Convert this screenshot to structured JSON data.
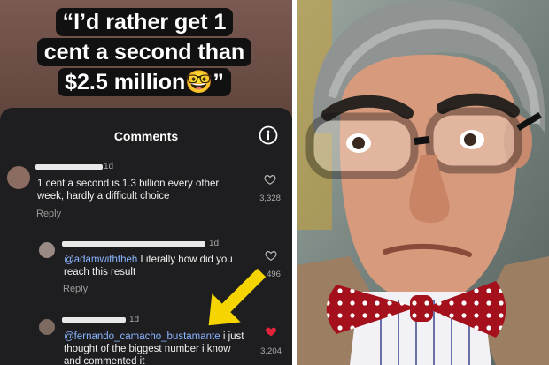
{
  "caption": {
    "line1": "“I’d rather get 1",
    "line2": "cent a second than",
    "line3": "$2.5 million🤓”"
  },
  "sheet": {
    "title": "Comments",
    "info_icon": "info-icon"
  },
  "comments": [
    {
      "time": "1d",
      "text": "1 cent a second is 1.3 billion every other week, hardly a difficult choice",
      "reply": "Reply",
      "likes": "3,328",
      "liked": false
    },
    {
      "time": "1d",
      "mention": "@adamwiththeh",
      "text": " Literally how did you reach this result",
      "reply": "Reply",
      "likes": "496",
      "liked": false
    },
    {
      "time": "1d",
      "mention": "@fernando_camacho_bustamante",
      "text": " i just thought of the biggest number i know and commented it",
      "likes": "3,204",
      "liked": true
    }
  ],
  "colors": {
    "arrow": "#f5d400",
    "heart_liked": "#e0243a",
    "mention": "#8ab4ff"
  }
}
